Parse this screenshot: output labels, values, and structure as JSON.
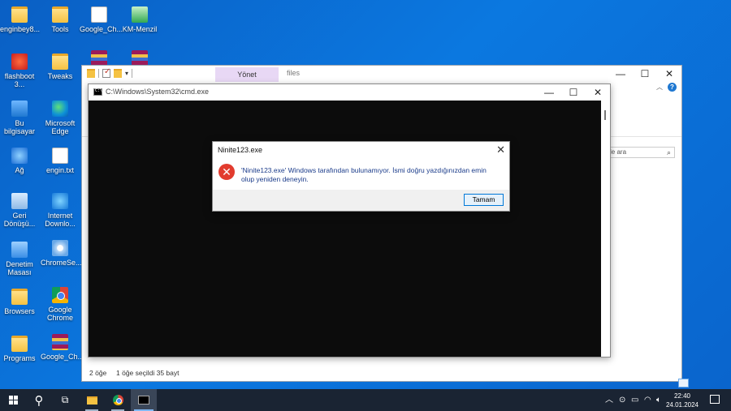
{
  "desktop": {
    "icons": [
      {
        "label": "enginbey8..."
      },
      {
        "label": "Tools"
      },
      {
        "label": "Google_Ch..."
      },
      {
        "label": "KM-Menzil"
      },
      {
        "label": "flashboot 3..."
      },
      {
        "label": "Tweaks"
      },
      {
        "label": "Bu bilgisayar"
      },
      {
        "label": "Microsoft Edge"
      },
      {
        "label": "Ağ"
      },
      {
        "label": "engin.txt"
      },
      {
        "label": "Geri Dönüşü..."
      },
      {
        "label": "Internet Downlo..."
      },
      {
        "label": "Denetim Masası"
      },
      {
        "label": "ChromeSe..."
      },
      {
        "label": "Browsers"
      },
      {
        "label": "Google Chrome"
      },
      {
        "label": "Programs"
      },
      {
        "label": "Google_Ch..."
      }
    ]
  },
  "explorer": {
    "manage_tab": "Yönet",
    "title": "files",
    "search_placeholder": "le ara",
    "status_items": "2 öğe",
    "status_selected": "1 öğe seçildi  35 bayt"
  },
  "cmd": {
    "title": "C:\\Windows\\System32\\cmd.exe"
  },
  "dialog": {
    "title": "Ninite123.exe",
    "message": "'Ninite123.exe' Windows tarafından bulunamıyor. İsmi doğru yazdığınızdan emin olup yeniden deneyin.",
    "ok_label": "Tamam"
  },
  "window_controls": {
    "minimize": "—",
    "maximize": "☐",
    "close": "✕"
  },
  "taskbar": {
    "time": "22:40",
    "date": "24.01.2024"
  }
}
